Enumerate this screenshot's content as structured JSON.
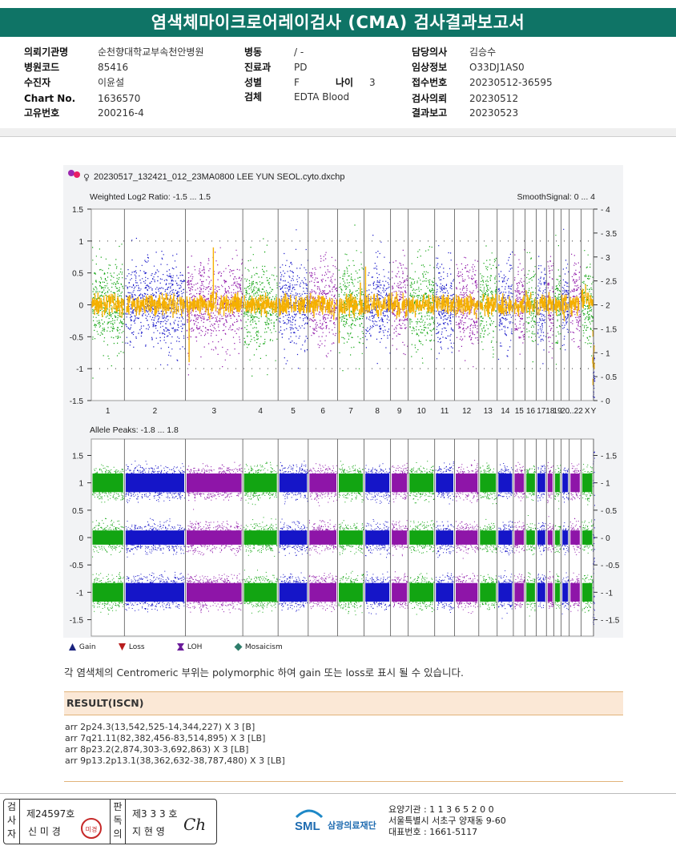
{
  "header": {
    "title": "염색체마이크로어레이검사 (CMA) 검사결과보고서"
  },
  "info": {
    "col1": [
      {
        "label": "의뢰기관명",
        "value": "순천향대학교부속천안병원"
      },
      {
        "label": "병원코드",
        "value": "85416"
      },
      {
        "label": "수진자",
        "value": "이윤설"
      },
      {
        "label": "Chart No.",
        "value": "1636570"
      },
      {
        "label": "고유번호",
        "value": "200216-4"
      }
    ],
    "col2": [
      {
        "label": "병동",
        "value": "/ -"
      },
      {
        "label": "진료과",
        "value": "PD"
      },
      {
        "label": "성별",
        "value": "F"
      },
      {
        "label": "검체",
        "value": "EDTA Blood"
      }
    ],
    "age": {
      "label": "나이",
      "value": "3"
    },
    "col3": [
      {
        "label": "담당의사",
        "value": "김승수"
      },
      {
        "label": "임상정보",
        "value": "O33DJ1AS0"
      },
      {
        "label": "접수번호",
        "value": "20230512-36595"
      },
      {
        "label": "검사의뢰",
        "value": "20230512"
      },
      {
        "label": "결과보고",
        "value": "20230523"
      }
    ]
  },
  "chart_data": [
    {
      "type": "scatter",
      "title": "20230517_132421_012_23MA0800 LEE YUN SEOL.cyto.dxchp",
      "ylabel": "Weighted Log2 Ratio: -1.5 ... 1.5",
      "y2label": "SmoothSignal: 0 ... 4",
      "ylim": [
        -1.5,
        1.5
      ],
      "y2lim": [
        0,
        4
      ],
      "yticks": [
        "1.5",
        "1",
        "0.5",
        "0",
        "-0.5",
        "-1",
        "-1.5"
      ],
      "y2ticks": [
        "4",
        "3.5",
        "3",
        "2.5",
        "2",
        "1.5",
        "1",
        "0.5",
        "0"
      ],
      "categories": [
        "1",
        "2",
        "3",
        "4",
        "5",
        "6",
        "7",
        "8",
        "9",
        "10",
        "11",
        "12",
        "13",
        "14",
        "15",
        "16",
        "17",
        "18",
        "19",
        "20",
        "...22",
        "X",
        "Y"
      ],
      "series": [],
      "smooth_signal_level": 2,
      "grid": true
    },
    {
      "type": "scatter",
      "ylabel": "Allele Peaks: -1.8 ... 1.8",
      "ylim": [
        -1.8,
        1.8
      ],
      "yticks": [
        "1.5",
        "1",
        "0.5",
        "0",
        "-0.5",
        "-1",
        "-1.5"
      ],
      "y2ticks": [
        "1.5",
        "1",
        "0.5",
        "0",
        "-0.5",
        "-1",
        "-1.5"
      ],
      "band_levels": [
        1,
        0,
        -1
      ],
      "categories": [
        "1",
        "2",
        "3",
        "4",
        "5",
        "6",
        "7",
        "8",
        "9",
        "10",
        "11",
        "12",
        "13",
        "14",
        "15",
        "16",
        "17",
        "18",
        "19",
        "20",
        "...22",
        "X",
        "Y"
      ],
      "grid": true
    }
  ],
  "chart_colors": [
    "#12a512",
    "#1515c8",
    "#8e15a8"
  ],
  "smooth_color": "#f5b000",
  "legend": [
    {
      "icon": "gain-triangle-icon",
      "label": "Gain",
      "color": "#1a237e"
    },
    {
      "icon": "loss-triangle-icon",
      "label": "Loss",
      "color": "#b71c1c"
    },
    {
      "icon": "loh-icon",
      "label": "LOH",
      "color": "#6a1b9a"
    },
    {
      "icon": "mosaicism-diamond-icon",
      "label": "Mosaicism",
      "color": "#2e7d6b"
    }
  ],
  "note": "각 염색체의 Centromeric 부위는 polymorphic 하여 gain 또는 loss로 표시 될 수 있습니다.",
  "result": {
    "title": "RESULT(ISCN)",
    "lines": [
      "arr 2p24.3(13,542,525-14,344,227) X 3 [B]",
      "arr 7q21.11(82,382,456-83,514,895) X 3 [LB]",
      "arr 8p23.2(2,874,303-3,692,863) X 3 [LB]",
      "arr 9p13.2p13.1(38,362,632-38,787,480) X 3 [LB]"
    ]
  },
  "signatures": {
    "inspector_label": "검사자",
    "inspector_no": "제24597호",
    "inspector_name": "신 미 경",
    "inspector_seal": "미경",
    "reviewer_label": "판독의",
    "reviewer_no": "제3 3 3 호",
    "reviewer_name": "지 현 영",
    "reviewer_sign": "Ch"
  },
  "organization": {
    "logo": "SML",
    "name": "삼광의료재단",
    "code_line": "요양기관 : 1 1 3 6 5 2 0 0",
    "address": "서울특별시 서초구 양재동 9-60",
    "phone": "대표번호 : 1661-5117"
  }
}
